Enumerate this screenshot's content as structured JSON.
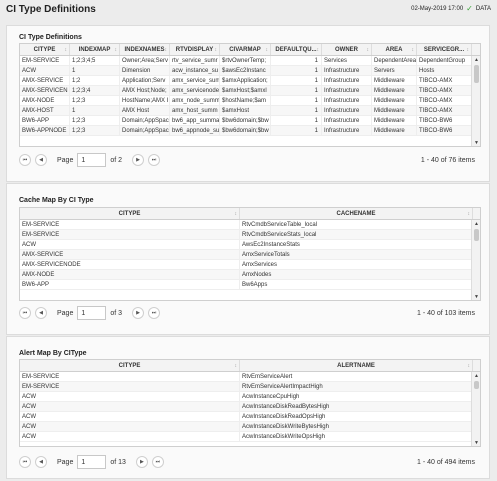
{
  "header": {
    "title": "CI Type Definitions",
    "timestamp": "02-May-2019 17:00",
    "status": "DATA",
    "status_color": "#3aa53a"
  },
  "panel1": {
    "title": "CI Type Definitions",
    "columns": [
      "CITYPE",
      "INDEXMAP",
      "INDEXNAMES",
      "RTVDISPLAY",
      "CIVARMAP",
      "DEFAULTQU...",
      "OWNER",
      "AREA",
      "SERVICEGR..."
    ],
    "rows": [
      [
        "EM-SERVICE",
        "1;2;3;4;5",
        "Owner;Area;Serv",
        "rtv_service_sumr",
        "$rtvOwnerTemp;",
        "1",
        "Services",
        "DependentAreas",
        "DependentGroup"
      ],
      [
        "ACW",
        "1",
        "Dimension",
        "acw_instance_su",
        "$awsEc2Instanc",
        "1",
        "Infrastructure",
        "Servers",
        "Hosts"
      ],
      [
        "AMX-SERVICE",
        "1;2",
        "Application;Serv",
        "amx_service_sum",
        "$amxApplication;",
        "1",
        "Infrastructure",
        "Middleware",
        "TIBCO-AMX"
      ],
      [
        "AMX-SERVICEN",
        "1;2;3;4",
        "AMX Host;Node;",
        "amx_servicenode",
        "$amxHost;$amxl",
        "1",
        "Infrastructure",
        "Middleware",
        "TIBCO-AMX"
      ],
      [
        "AMX-NODE",
        "1;2;3",
        "HostName;AMX I",
        "amx_node_summ",
        "$hostName;$am",
        "1",
        "Infrastructure",
        "Middleware",
        "TIBCO-AMX"
      ],
      [
        "AMX-HOST",
        "1",
        "AMX Host",
        "amx_host_summ",
        "$amxHost",
        "1",
        "Infrastructure",
        "Middleware",
        "TIBCO-AMX"
      ],
      [
        "BW6-APP",
        "1;2;3",
        "Domain;AppSpac",
        "bw6_app_summa",
        "$bw6domain;$bw",
        "1",
        "Infrastructure",
        "Middleware",
        "TIBCO-BW6"
      ],
      [
        "BW6-APPNODE",
        "1;2;3",
        "Domain;AppSpac",
        "bw6_appnode_su",
        "$bw6domain;$bw",
        "1",
        "Infrastructure",
        "Middleware",
        "TIBCO-BW6"
      ]
    ],
    "page_label": "Page",
    "page_value": "1",
    "page_of": "of 2",
    "items_info": "1 - 40 of 76 items"
  },
  "panel2": {
    "title": "Cache Map By CI Type",
    "columns": [
      "CITYPE",
      "CACHENAME"
    ],
    "rows": [
      [
        "EM-SERVICE",
        "RtvCmdbServiceTable_local"
      ],
      [
        "EM-SERVICE",
        "RtvCmdbServiceStats_local"
      ],
      [
        "ACW",
        "AwsEc2InstanceStats"
      ],
      [
        "AMX-SERVICE",
        "AmxServiceTotals"
      ],
      [
        "AMX-SERVICENODE",
        "AmxServices"
      ],
      [
        "AMX-NODE",
        "AmxNodes"
      ],
      [
        "BW6-APP",
        "Bw6Apps"
      ]
    ],
    "page_label": "Page",
    "page_value": "1",
    "page_of": "of 3",
    "items_info": "1 - 40 of 103 items"
  },
  "panel3": {
    "title": "Alert Map By CIType",
    "columns": [
      "CITYPE",
      "ALERTNAME"
    ],
    "rows": [
      [
        "EM-SERVICE",
        "RtvEmServiceAlert"
      ],
      [
        "EM-SERVICE",
        "RtvEmServiceAlertImpactHigh"
      ],
      [
        "ACW",
        "AcwInstanceCpuHigh"
      ],
      [
        "ACW",
        "AcwInstanceDiskReadBytesHigh"
      ],
      [
        "ACW",
        "AcwInstanceDiskReadOpsHigh"
      ],
      [
        "ACW",
        "AcwInstanceDiskWriteBytesHigh"
      ],
      [
        "ACW",
        "AcwInstanceDiskWriteOpsHigh"
      ]
    ],
    "page_label": "Page",
    "page_value": "1",
    "page_of": "of 13",
    "items_info": "1 - 40 of 494 items"
  },
  "icons": {
    "sort": "↕",
    "first": "⏮",
    "prev": "◀",
    "next": "▶",
    "last": "⏭",
    "scroll_up": "▲",
    "scroll_down": "▼",
    "check": "✓"
  }
}
